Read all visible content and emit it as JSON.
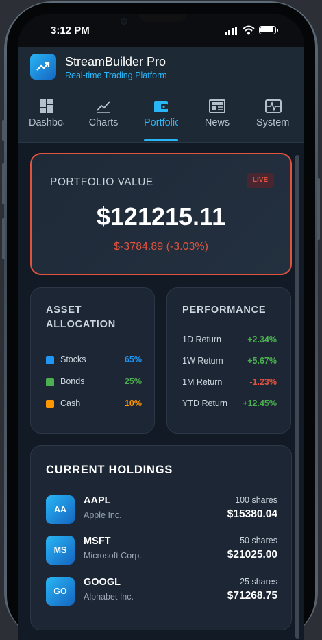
{
  "status": {
    "time": "3:12 PM"
  },
  "app": {
    "title": "StreamBuilder Pro",
    "subtitle": "Real-time Trading Platform"
  },
  "tabs": [
    {
      "label": "Dashboard",
      "icon": "dashboard-icon"
    },
    {
      "label": "Charts",
      "icon": "chart-line-icon"
    },
    {
      "label": "Portfolio",
      "icon": "wallet-icon",
      "active": true
    },
    {
      "label": "News",
      "icon": "newspaper-icon"
    },
    {
      "label": "System",
      "icon": "pulse-monitor-icon"
    }
  ],
  "portfolio": {
    "label": "PORTFOLIO VALUE",
    "badge": "LIVE",
    "value": "$121215.11",
    "change": "$-3784.89 (-3.03%)"
  },
  "allocation": {
    "title": "ASSET ALLOCATION",
    "items": [
      {
        "name": "Stocks",
        "pct": "65%",
        "color": "#2196f3"
      },
      {
        "name": "Bonds",
        "pct": "25%",
        "color": "#4caf50"
      },
      {
        "name": "Cash",
        "pct": "10%",
        "color": "#ff9800"
      }
    ]
  },
  "performance": {
    "title": "PERFORMANCE",
    "items": [
      {
        "label": "1D Return",
        "value": "+2.34%",
        "color": "#4caf50"
      },
      {
        "label": "1W Return",
        "value": "+5.67%",
        "color": "#4caf50"
      },
      {
        "label": "1M Return",
        "value": "-1.23%",
        "color": "#e0533f"
      },
      {
        "label": "YTD Return",
        "value": "+12.45%",
        "color": "#4caf50"
      }
    ]
  },
  "holdings": {
    "title": "CURRENT HOLDINGS",
    "items": [
      {
        "badge": "AA",
        "symbol": "AAPL",
        "name": "Apple Inc.",
        "shares": "100 shares",
        "value": "$15380.04"
      },
      {
        "badge": "MS",
        "symbol": "MSFT",
        "name": "Microsoft Corp.",
        "shares": "50 shares",
        "value": "$21025.00"
      },
      {
        "badge": "GO",
        "symbol": "GOOGL",
        "name": "Alphabet Inc.",
        "shares": "25 shares",
        "value": "$71268.75"
      }
    ]
  },
  "colors": {
    "accent": "#29b6f6",
    "negative": "#e0533f",
    "positive": "#4caf50"
  }
}
